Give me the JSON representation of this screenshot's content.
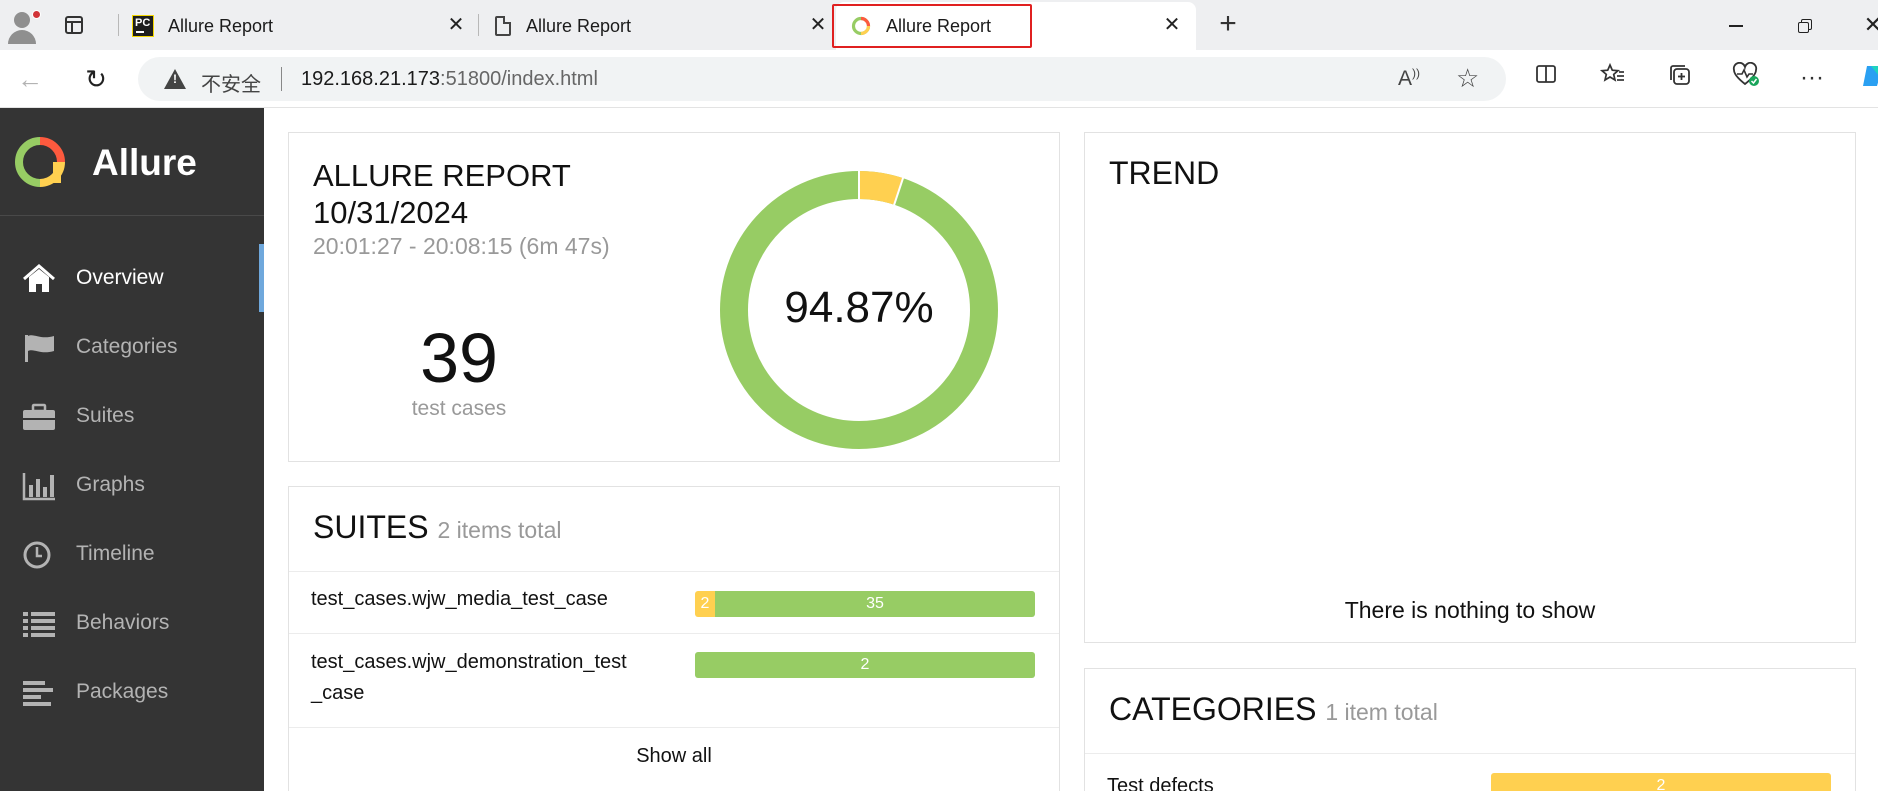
{
  "browser": {
    "tabs": [
      {
        "title": "Allure Report",
        "icon": "pycharm-icon",
        "active": false
      },
      {
        "title": "Allure Report",
        "icon": "page-icon",
        "active": false
      },
      {
        "title": "Allure Report",
        "icon": "allure-icon",
        "active": true
      }
    ],
    "pc_icon_text": "PC",
    "address": {
      "security_label": "不安全",
      "url_host": "192.168.21.173",
      "url_rest": ":51800/index.html"
    },
    "highlight_color": "#e02020"
  },
  "sidebar": {
    "brand": "Allure",
    "items": [
      {
        "label": "Overview",
        "icon": "home-icon",
        "active": true
      },
      {
        "label": "Categories",
        "icon": "flag-icon",
        "active": false
      },
      {
        "label": "Suites",
        "icon": "briefcase-icon",
        "active": false
      },
      {
        "label": "Graphs",
        "icon": "bar-chart-icon",
        "active": false
      },
      {
        "label": "Timeline",
        "icon": "clock-icon",
        "active": false
      },
      {
        "label": "Behaviors",
        "icon": "list-icon",
        "active": false
      },
      {
        "label": "Packages",
        "icon": "align-left-icon",
        "active": false
      }
    ]
  },
  "summary": {
    "title": "ALLURE REPORT",
    "date": "10/31/2024",
    "time_range": "20:01:27 - 20:08:15 (6m 47s)",
    "test_cases_count": "39",
    "test_cases_label": "test cases",
    "success_rate": "94.87%",
    "donut": {
      "passed": 37,
      "broken": 2
    }
  },
  "suites": {
    "title": "SUITES",
    "subtitle": "2 items total",
    "rows": [
      {
        "name": "test_cases.wjw_media_test_case",
        "broken": 2,
        "passed": 35
      },
      {
        "name": "test_cases.wjw_demonstration_test _case",
        "broken": 0,
        "passed": 2
      }
    ],
    "show_all": "Show all"
  },
  "trend": {
    "title": "TREND",
    "empty_text": "There is nothing to show"
  },
  "categories": {
    "title": "CATEGORIES",
    "subtitle": "1 item total",
    "rows": [
      {
        "name": "Test defects",
        "count": "2"
      }
    ]
  },
  "colors": {
    "passed": "#97cc64",
    "broken": "#ffd050",
    "sidebar": "#343434",
    "active_indicator": "#6fa8dc"
  }
}
